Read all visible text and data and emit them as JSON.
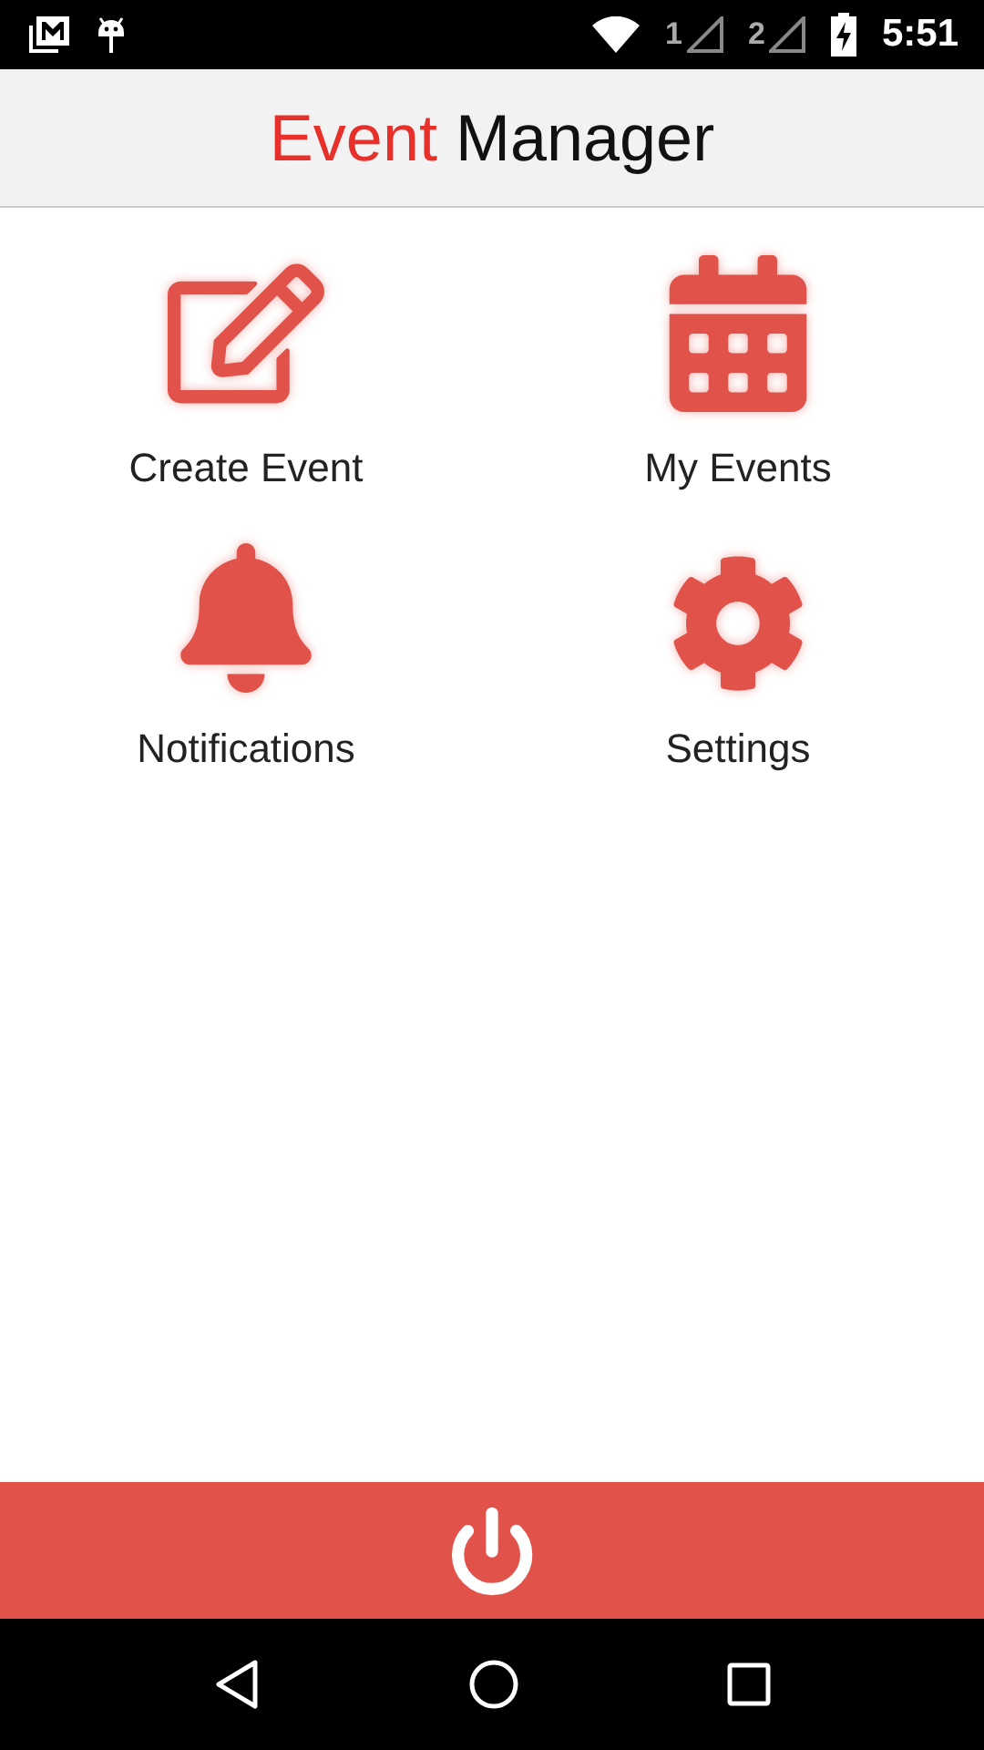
{
  "status_bar": {
    "sim_1": "1",
    "sim_2": "2",
    "time": "5:51"
  },
  "title": {
    "accent": "Event",
    "rest": "Manager"
  },
  "menu": [
    {
      "kind": "create",
      "label": "Create Event"
    },
    {
      "kind": "calendar",
      "label": "My Events"
    },
    {
      "kind": "bell",
      "label": "Notifications"
    },
    {
      "kind": "gear",
      "label": "Settings"
    }
  ]
}
